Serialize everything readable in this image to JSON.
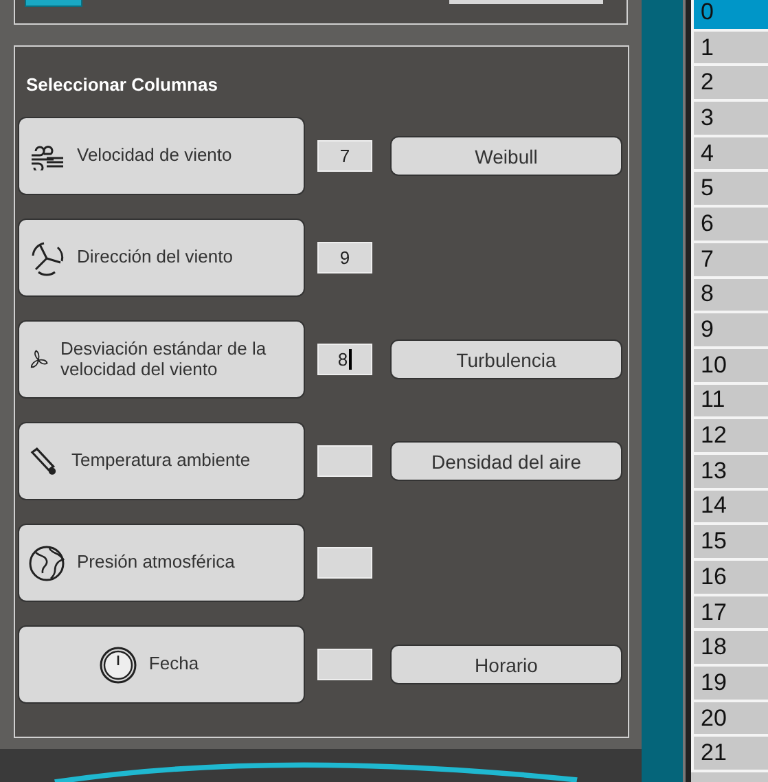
{
  "panel": {
    "title": "Seleccionar Columnas"
  },
  "columns": [
    {
      "label": "Velocidad de viento",
      "value": "7",
      "focused": false,
      "action": "Weibull",
      "centered": false
    },
    {
      "label": "Dirección del viento",
      "value": "9",
      "focused": false,
      "centered": false
    },
    {
      "label": "Desviación estándar de la velocidad del viento",
      "value": "8",
      "focused": true,
      "action": "Turbulencia",
      "centered": false
    },
    {
      "label": "Temperatura ambiente",
      "focused": false,
      "action": "Densidad del aire",
      "centered": false
    },
    {
      "label": "Presión atmosférica",
      "focused": false,
      "centered": false
    },
    {
      "label": "Fecha",
      "focused": false,
      "action": "Horario",
      "centered": true
    }
  ],
  "row_headers": [
    {
      "label": "0",
      "selected": true
    },
    {
      "label": "1",
      "selected": false
    },
    {
      "label": "2",
      "selected": false
    },
    {
      "label": "3",
      "selected": false
    },
    {
      "label": "4",
      "selected": false
    },
    {
      "label": "5",
      "selected": false
    },
    {
      "label": "6",
      "selected": false
    },
    {
      "label": "7",
      "selected": false
    },
    {
      "label": "8",
      "selected": false
    },
    {
      "label": "9",
      "selected": false
    },
    {
      "label": "10",
      "selected": false
    },
    {
      "label": "11",
      "selected": false
    },
    {
      "label": "12",
      "selected": false
    },
    {
      "label": "13",
      "selected": false
    },
    {
      "label": "14",
      "selected": false
    },
    {
      "label": "15",
      "selected": false
    },
    {
      "label": "16",
      "selected": false
    },
    {
      "label": "17",
      "selected": false
    },
    {
      "label": "18",
      "selected": false
    },
    {
      "label": "19",
      "selected": false
    },
    {
      "label": "20",
      "selected": false
    },
    {
      "label": "21",
      "selected": false
    }
  ]
}
